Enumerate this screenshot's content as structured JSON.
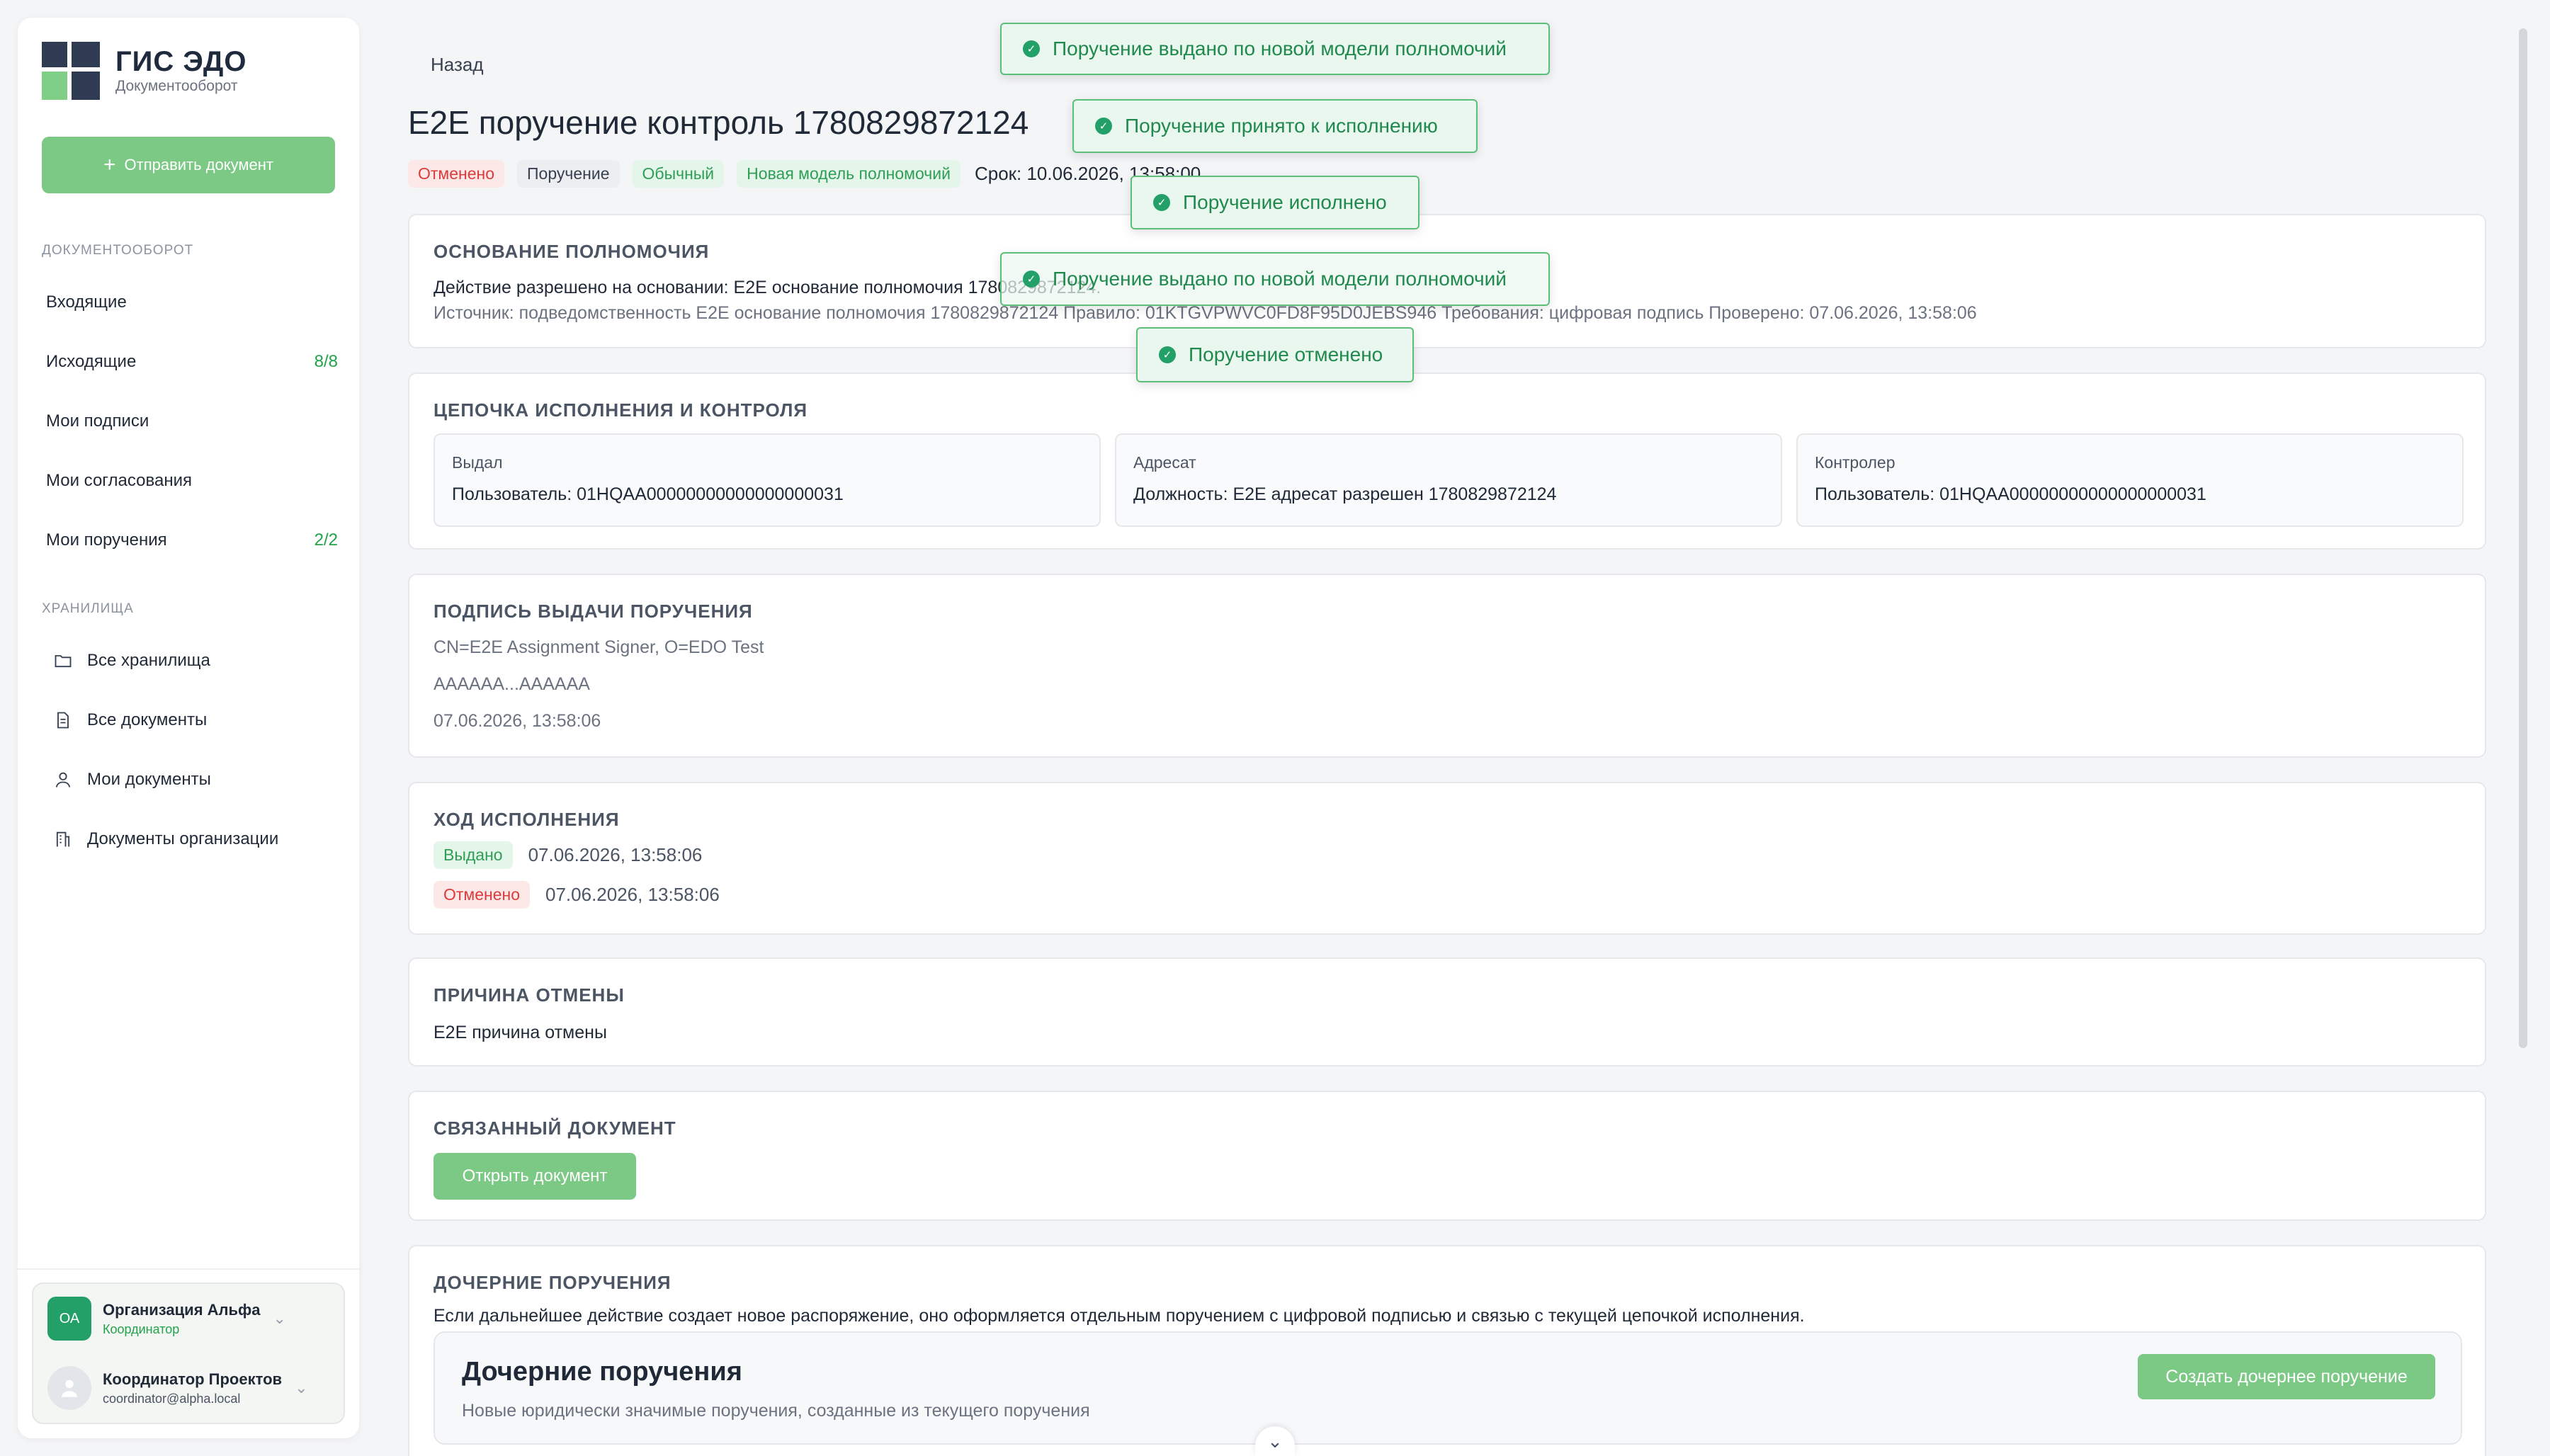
{
  "sidebar": {
    "logo_title": "ГИС ЭДО",
    "logo_subtitle": "Документооборот",
    "send_button": "Отправить документ",
    "section_docflow": "ДОКУМЕНТООБОРОТ",
    "nav": [
      {
        "label": "Входящие",
        "count": ""
      },
      {
        "label": "Исходящие",
        "count": "8/8"
      },
      {
        "label": "Мои подписи",
        "count": ""
      },
      {
        "label": "Мои согласования",
        "count": ""
      },
      {
        "label": "Мои поручения",
        "count": "2/2"
      }
    ],
    "section_storage": "ХРАНИЛИЩА",
    "storage": [
      {
        "label": "Все хранилища",
        "icon": "folder-icon"
      },
      {
        "label": "Все документы",
        "icon": "document-icon"
      },
      {
        "label": "Мои документы",
        "icon": "user-icon"
      },
      {
        "label": "Документы организации",
        "icon": "building-icon"
      }
    ],
    "org": {
      "initials": "ОА",
      "name": "Организация Альфа",
      "role": "Координатор"
    },
    "user": {
      "name": "Координатор Проектов",
      "email": "coordinator@alpha.local"
    }
  },
  "header": {
    "back": "Назад",
    "title": "E2E поручение контроль 1780829872124",
    "tags": [
      "Отменено",
      "Поручение",
      "Обычный",
      "Новая модель полномочий"
    ],
    "deadline": "Срок: 10.06.2026, 13:58:00"
  },
  "basis": {
    "title": "ОСНОВАНИЕ ПОЛНОМОЧИЯ",
    "text": "Действие разрешено на основании: E2E основание полномочия 1780829872124.",
    "details": "Источник: подведомственность  E2E основание полномочия 1780829872124  Правило: 01KTGVPWVC0FD8F95D0JEBS946  Требования: цифровая подпись  Проверено: 07.06.2026, 13:58:06"
  },
  "chain": {
    "title": "ЦЕПОЧКА ИСПОЛНЕНИЯ И КОНТРОЛЯ",
    "parties": [
      {
        "label": "Выдал",
        "value": "Пользователь: 01HQAA00000000000000000031"
      },
      {
        "label": "Адресат",
        "value": "Должность: E2E адресат разрешен 1780829872124"
      },
      {
        "label": "Контролер",
        "value": "Пользователь: 01HQAA00000000000000000031"
      }
    ]
  },
  "signature": {
    "title": "ПОДПИСЬ ВЫДАЧИ ПОРУЧЕНИЯ",
    "subject": "CN=E2E Assignment Signer, O=EDO Test",
    "value": "AAAAAA...AAAAAA",
    "date": "07.06.2026, 13:58:06"
  },
  "progress": {
    "title": "ХОД ИСПОЛНЕНИЯ",
    "events": [
      {
        "status": "Выдано",
        "date": "07.06.2026, 13:58:06"
      },
      {
        "status": "Отменено",
        "date": "07.06.2026, 13:58:06"
      }
    ]
  },
  "cancel_reason": {
    "title": "ПРИЧИНА ОТМЕНЫ",
    "text": "E2E причина отмены"
  },
  "linked_doc": {
    "title": "СВЯЗАННЫЙ ДОКУМЕНТ",
    "button": "Открыть документ"
  },
  "children": {
    "title": "ДОЧЕРНИЕ ПОРУЧЕНИЯ",
    "text": "Если дальнейшее действие создает новое распоряжение, оно оформляется отдельным поручением с цифровой подписью и связью с текущей цепочкой исполнения.",
    "panel_title": "Дочерние поручения",
    "panel_subtitle": "Новые юридически значимые поручения, созданные из текущего поручения",
    "create_button": "Создать дочернее поручение"
  },
  "toasts": [
    "Поручение выдано по новой модели полномочий",
    "Поручение принято к исполнению",
    "Поручение исполнено",
    "Поручение выдано по новой модели полномочий",
    "Поручение отменено"
  ],
  "colors": {
    "accent": "#7cc986",
    "success": "#23a067",
    "danger": "#dc3b3b"
  }
}
